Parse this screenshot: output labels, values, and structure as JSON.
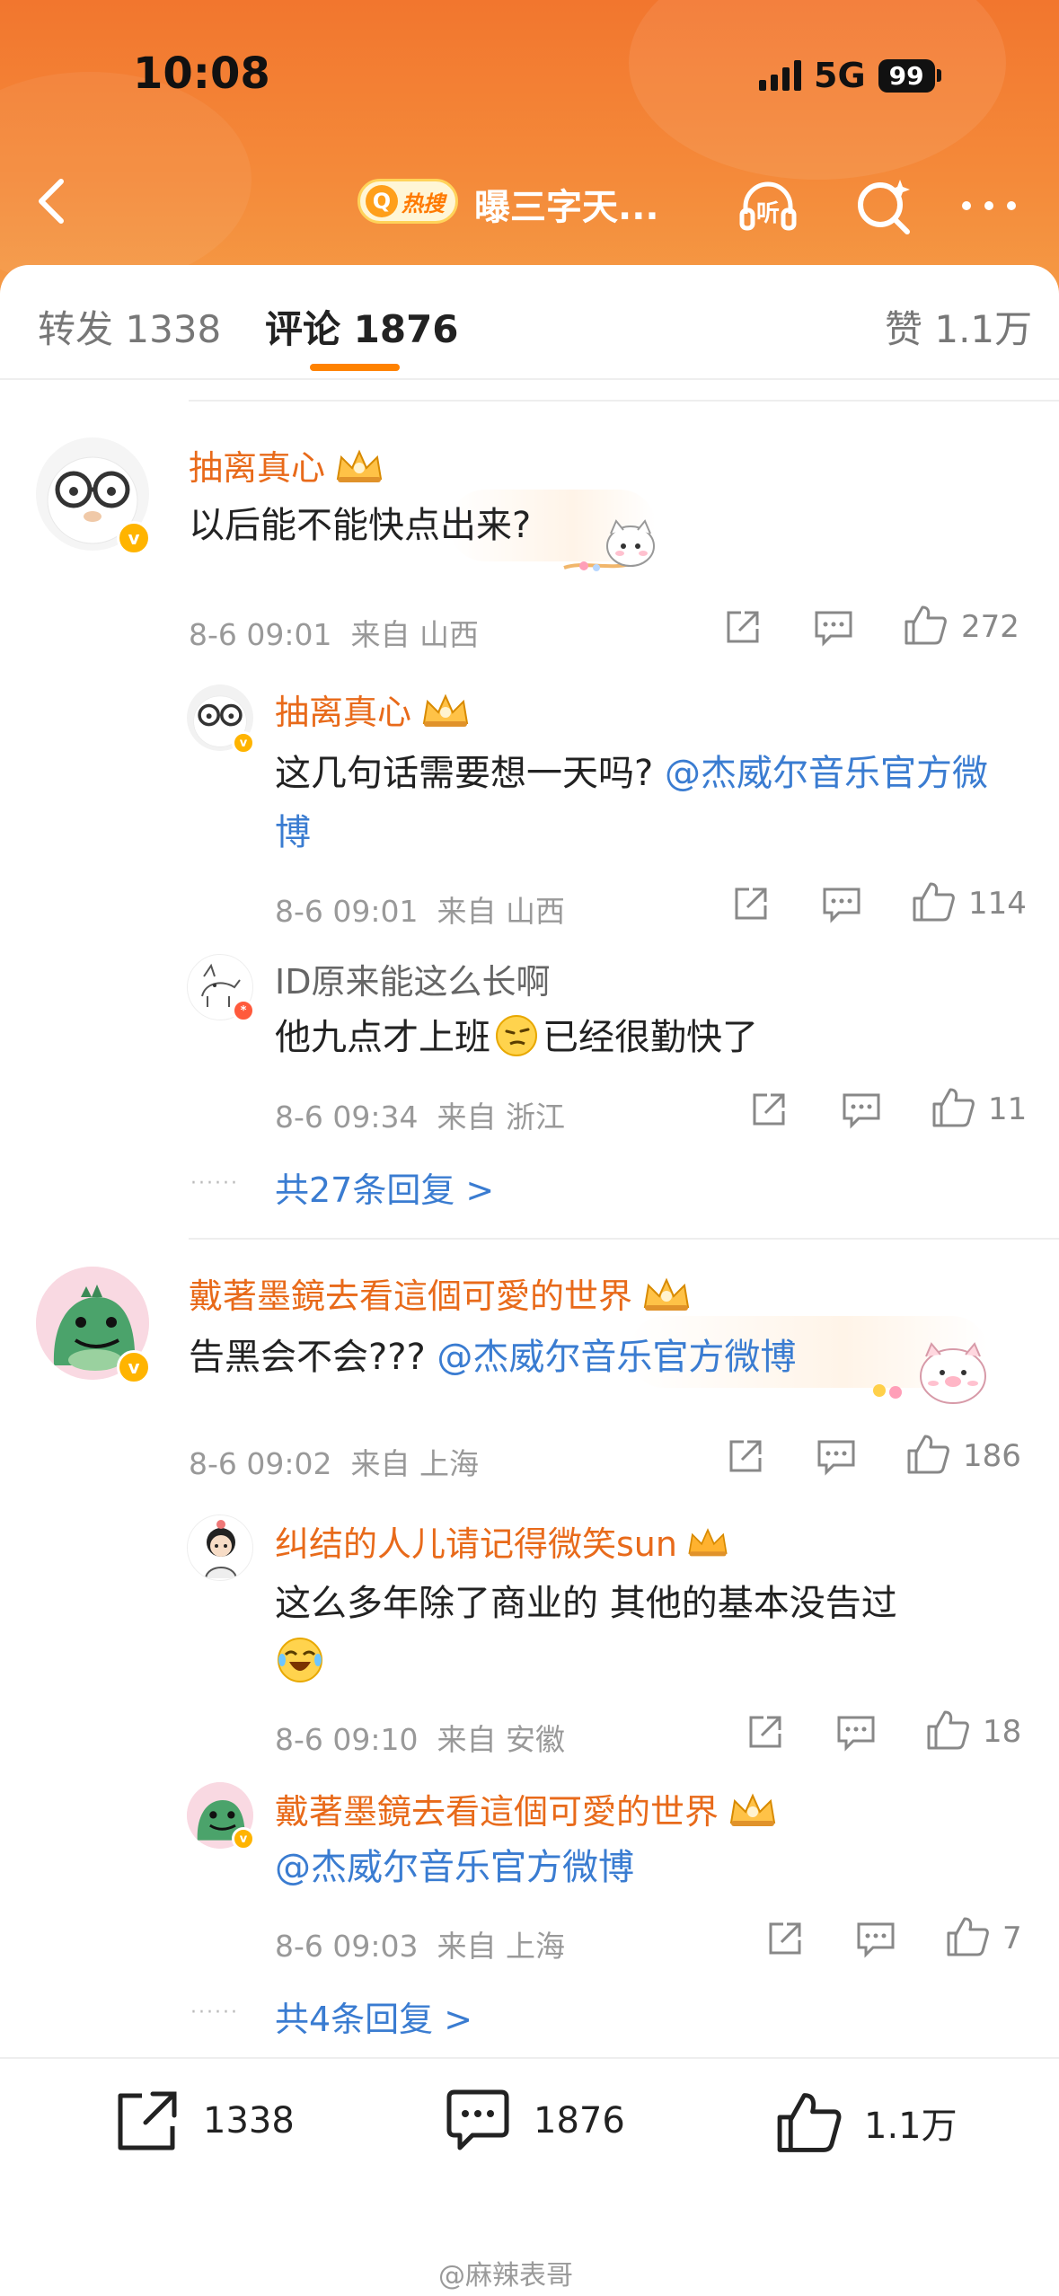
{
  "status_bar": {
    "time": "10:08",
    "network": "5G",
    "battery": "99"
  },
  "nav": {
    "hot_badge": "热搜",
    "title": "曝三字天...",
    "back_icon": "chevron-left-icon",
    "listen_icon": "headphones-listen-icon",
    "search_icon": "search-sparkle-icon",
    "more_icon": "more-dots-icon",
    "listen_glyph": "听"
  },
  "tabs": {
    "repost": "转发 1338",
    "comments": "评论 1876",
    "likes": "赞 1.1万"
  },
  "comments": [
    {
      "user": "抽离真心",
      "text": "以后能不能快点出来?",
      "time": "8-6 09:01",
      "location": "来自 山西",
      "likes": "272",
      "replies": [
        {
          "user": "抽离真心",
          "text": "这几句话需要想一天吗?",
          "mention": "@杰威尔音乐官方微博",
          "time": "8-6 09:01",
          "location": "来自 山西",
          "likes": "114"
        },
        {
          "user": "ID原来能这么长啊",
          "text_before": "他九点才上班",
          "text_after": "已经很勤快了",
          "time": "8-6 09:34",
          "location": "来自 浙江",
          "likes": "11"
        }
      ],
      "more_replies": "共27条回复 >"
    },
    {
      "user": "戴著墨鏡去看這個可愛的世界",
      "text": "告黑会不会???",
      "mention": "@杰威尔音乐官方微博",
      "time": "8-6 09:02",
      "location": "来自 上海",
      "likes": "186",
      "replies": [
        {
          "user": "纠结的人儿请记得微笑sun",
          "text": "这么多年除了商业的 其他的基本没告过",
          "time": "8-6 09:10",
          "location": "来自 安徽",
          "likes": "18"
        },
        {
          "user": "戴著墨鏡去看這個可愛的世界",
          "mention": "@杰威尔音乐官方微博",
          "time": "8-6 09:03",
          "location": "来自 上海",
          "likes": "7"
        }
      ],
      "more_replies": "共4条回复 >"
    }
  ],
  "bottom_bar": {
    "reposts": "1338",
    "comments": "1876",
    "likes": "1.1万"
  },
  "watermark": "@麻辣表哥",
  "colors": {
    "accent": "#ff8200",
    "username": "#e86a1a",
    "mention": "#3a7cd1",
    "header": "#f2762e"
  }
}
